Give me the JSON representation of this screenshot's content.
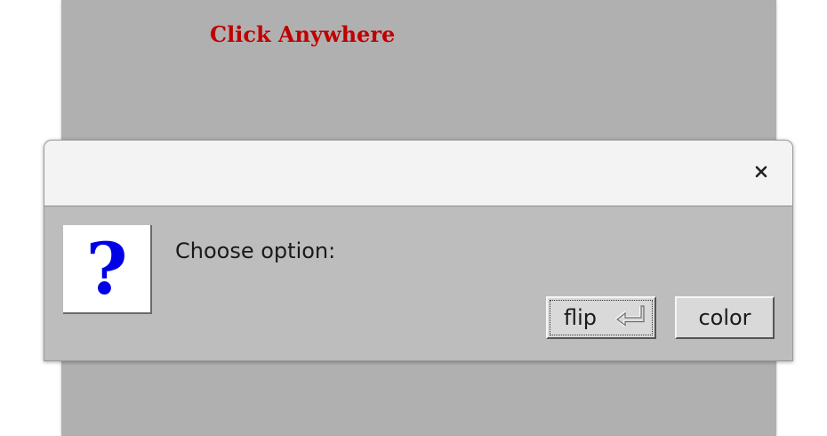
{
  "app": {
    "heading": "Click Anywhere",
    "heading_color": "#c00000",
    "background_color": "#b0b0b0"
  },
  "dialog": {
    "close_icon": "close-icon",
    "question_icon": "?",
    "message": "Choose option:",
    "buttons": [
      {
        "label": "flip",
        "icon": "enter-key-icon",
        "default": true
      },
      {
        "label": "color"
      }
    ]
  }
}
